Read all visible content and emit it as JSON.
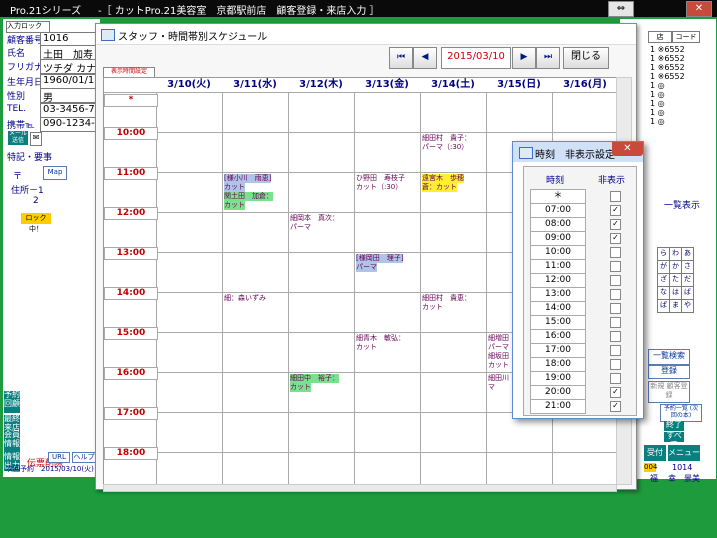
{
  "app": {
    "title_left": "Pro.21シリーズ",
    "title_main": "-［ カットPro.21美容室　京都駅前店　顧客登録・来店入力 ］",
    "win_buttons": [
      "⇔",
      "✕"
    ]
  },
  "customer": {
    "entry_lock": "入力ロック",
    "fields": [
      {
        "label": "顧客番号",
        "value": "1016"
      },
      {
        "label": "氏名",
        "value": "土田　加寿"
      },
      {
        "label": "フリガナ",
        "value": "ツチダ カナ"
      },
      {
        "label": "生年月日",
        "value": "1960/01/1"
      },
      {
        "label": "性別",
        "value": "男"
      },
      {
        "label": "TEL.",
        "value": "03-3456-78"
      },
      {
        "label": "携帯℡",
        "value": "090-1234-5"
      }
    ],
    "mail_btn": "メール送信",
    "mail_mark": "✉",
    "special_label": "特記・要事",
    "zip_label": "〒",
    "map_btn": "Map",
    "address1_label": "住所－1",
    "address2_label": "2",
    "lock_badge": "ロック中！",
    "side_buttons": [
      "予約 回顧",
      "最終 来店",
      "会員 情報",
      "情報 出力"
    ],
    "delete_label": "伝票削除",
    "unpaid_label": "未収分",
    "url_btn": "URL",
    "help_btn": "ヘルプ",
    "next_visit": "次回予約　2015/03/10(火)"
  },
  "right_panel": {
    "tabs": [
      "店",
      "コード"
    ],
    "lines": [
      "1 ※6552",
      "1 ※6552",
      "1 ※6552",
      "1 ※6552",
      "1 ◎",
      "1 ◎",
      "1 ◎",
      "1 ◎",
      "1 ◎"
    ],
    "list_label": "一覧表示",
    "kana_keys": [
      "ら",
      "わ",
      "あ",
      "が",
      "か",
      "さ",
      "ざ",
      "た",
      "だ",
      "な",
      "は",
      "ば",
      "ぱ",
      "ま",
      "や"
    ],
    "month_btn": "月",
    "buttons": [
      "一覧検索",
      "登録",
      "新規 顧客登録",
      "予約一覧 (次回の本)",
      "終了",
      "すべて",
      "受付",
      "メニュー"
    ],
    "footer_num": "1014",
    "footer_names": [
      "福",
      "幸",
      "景美"
    ],
    "footer_code": "004"
  },
  "schedule": {
    "title": "スタッフ・時間帯別スケジュール",
    "date": "2015/03/10",
    "close": "閉じる",
    "nav": [
      "⏮",
      "◀",
      "▶",
      "⏭"
    ],
    "display_settings": "表示時間設定",
    "days": [
      "3/10(火)",
      "3/11(水)",
      "3/12(木)",
      "3/13(金)",
      "3/14(土)",
      "3/15(日)",
      "3/16(月)"
    ],
    "times": [
      "*",
      "10:00",
      "11:00",
      "12:00",
      "13:00",
      "14:00",
      "15:00",
      "16:00",
      "17:00",
      "18:00"
    ],
    "appointments": [
      {
        "day": 4,
        "slot": 1,
        "off": 0,
        "text": "細田村　貴子：",
        "hl": ""
      },
      {
        "day": 4,
        "slot": 1,
        "off": 1,
        "text": "パーマ（:30）",
        "hl": ""
      },
      {
        "day": 1,
        "slot": 2,
        "off": 0,
        "text": "[様小川　雨恵]",
        "hl": "blue"
      },
      {
        "day": 1,
        "slot": 2,
        "off": 1,
        "text": "カット",
        "hl": "blue"
      },
      {
        "day": 1,
        "slot": 2,
        "off": 2,
        "text": "関土田　加倉：",
        "hl": "green"
      },
      {
        "day": 1,
        "slot": 2,
        "off": 3,
        "text": "カット",
        "hl": "green"
      },
      {
        "day": 3,
        "slot": 2,
        "off": 0,
        "text": "ひ野田　寿枝子",
        "hl": ""
      },
      {
        "day": 3,
        "slot": 2,
        "off": 1,
        "text": "カット（:30）",
        "hl": ""
      },
      {
        "day": 4,
        "slot": 2,
        "off": 0,
        "text": "遠宮木　歩穂",
        "hl": "yellow"
      },
      {
        "day": 4,
        "slot": 2,
        "off": 1,
        "text": "蒼：カット",
        "hl": "yellow"
      },
      {
        "day": 2,
        "slot": 3,
        "off": 0,
        "text": "細岡本　真次：",
        "hl": ""
      },
      {
        "day": 2,
        "slot": 3,
        "off": 1,
        "text": "パーマ",
        "hl": ""
      },
      {
        "day": 3,
        "slot": 4,
        "off": 0,
        "text": "[様岡田　理子]",
        "hl": "blue"
      },
      {
        "day": 3,
        "slot": 4,
        "off": 1,
        "text": "パーマ",
        "hl": "blue"
      },
      {
        "day": 1,
        "slot": 5,
        "off": 0,
        "text": "細：森いずみ",
        "hl": ""
      },
      {
        "day": 4,
        "slot": 5,
        "off": 0,
        "text": "細田村　貴恵：",
        "hl": ""
      },
      {
        "day": 4,
        "slot": 5,
        "off": 1,
        "text": "カット",
        "hl": ""
      },
      {
        "day": 3,
        "slot": 6,
        "off": 0,
        "text": "細青木　敏弘：",
        "hl": ""
      },
      {
        "day": 3,
        "slot": 6,
        "off": 1,
        "text": "カット",
        "hl": ""
      },
      {
        "day": 5,
        "slot": 6,
        "off": 0,
        "text": "細増田",
        "hl": ""
      },
      {
        "day": 5,
        "slot": 6,
        "off": 1,
        "text": "パーマ",
        "hl": ""
      },
      {
        "day": 5,
        "slot": 6,
        "off": 2,
        "text": "細坂田",
        "hl": ""
      },
      {
        "day": 5,
        "slot": 6,
        "off": 3,
        "text": "カット",
        "hl": ""
      },
      {
        "day": 2,
        "slot": 7,
        "off": 0,
        "text": "細田中　裕子：",
        "hl": "green"
      },
      {
        "day": 2,
        "slot": 7,
        "off": 1,
        "text": "カット",
        "hl": "green"
      },
      {
        "day": 5,
        "slot": 7,
        "off": 0,
        "text": "細田川",
        "hl": ""
      },
      {
        "day": 5,
        "slot": 7,
        "off": 1,
        "text": "マ",
        "hl": ""
      }
    ]
  },
  "hide_dialog": {
    "title": "時刻　非表示設定",
    "col_time": "時刻",
    "col_hide": "非表示",
    "close": "✕",
    "rows": [
      {
        "time": "＊",
        "hidden": false
      },
      {
        "time": "07:00",
        "hidden": true
      },
      {
        "time": "08:00",
        "hidden": true
      },
      {
        "time": "09:00",
        "hidden": true
      },
      {
        "time": "10:00",
        "hidden": false
      },
      {
        "time": "11:00",
        "hidden": false
      },
      {
        "time": "12:00",
        "hidden": false
      },
      {
        "time": "13:00",
        "hidden": false
      },
      {
        "time": "14:00",
        "hidden": false
      },
      {
        "time": "15:00",
        "hidden": false
      },
      {
        "time": "16:00",
        "hidden": false
      },
      {
        "time": "17:00",
        "hidden": false
      },
      {
        "time": "18:00",
        "hidden": false
      },
      {
        "time": "19:00",
        "hidden": false
      },
      {
        "time": "20:00",
        "hidden": true
      },
      {
        "time": "21:00",
        "hidden": true
      }
    ]
  }
}
